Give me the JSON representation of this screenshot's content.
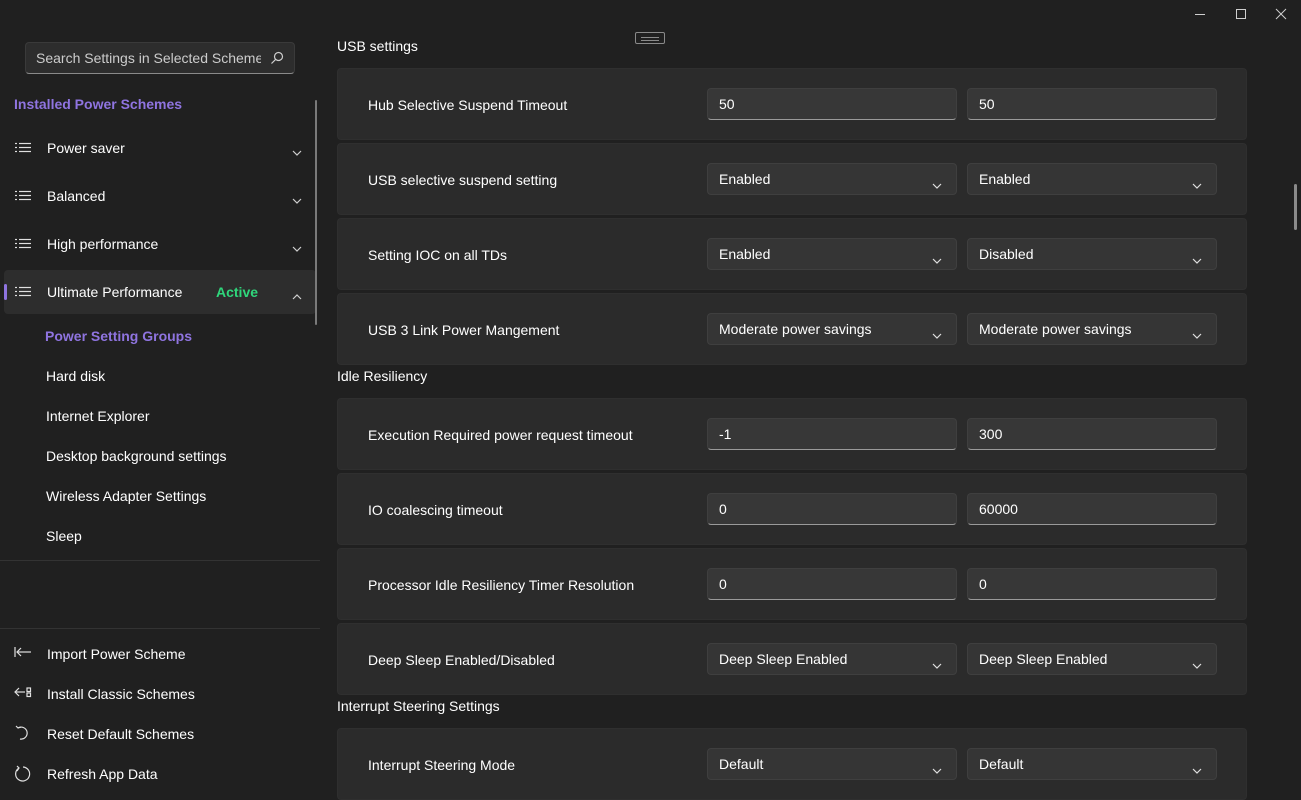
{
  "window": {
    "minimize": "minimize",
    "maximize": "maximize",
    "close": "close"
  },
  "sidebar": {
    "search_placeholder": "Search Settings in Selected Scheme",
    "section_title": "Installed Power Schemes",
    "schemes": [
      {
        "label": "Power saver",
        "expanded": false
      },
      {
        "label": "Balanced",
        "expanded": false
      },
      {
        "label": "High performance",
        "expanded": false
      },
      {
        "label": "Ultimate Performance",
        "expanded": true,
        "badge": "Active"
      }
    ],
    "group_header": "Power Setting Groups",
    "groups": [
      "Hard disk",
      "Internet Explorer",
      "Desktop background settings",
      "Wireless Adapter Settings",
      "Sleep"
    ],
    "actions": [
      {
        "label": "Import Power Scheme",
        "icon": "import-icon"
      },
      {
        "label": "Install Classic Schemes",
        "icon": "install-icon"
      },
      {
        "label": "Reset Default Schemes",
        "icon": "reset-icon"
      },
      {
        "label": "Refresh App Data",
        "icon": "refresh-icon"
      }
    ]
  },
  "main": {
    "sections": [
      {
        "title": "USB settings",
        "settings": [
          {
            "name": "Hub Selective Suspend Timeout",
            "type": "text",
            "value1": "50",
            "value2": "50"
          },
          {
            "name": "USB selective suspend setting",
            "type": "select",
            "value1": "Enabled",
            "value2": "Enabled"
          },
          {
            "name": "Setting IOC on all TDs",
            "type": "select",
            "value1": "Enabled",
            "value2": "Disabled"
          },
          {
            "name": "USB 3 Link Power Mangement",
            "type": "select",
            "value1": "Moderate power savings",
            "value2": "Moderate power savings"
          }
        ]
      },
      {
        "title": "Idle Resiliency",
        "settings": [
          {
            "name": "Execution Required power request timeout",
            "type": "text",
            "value1": "-1",
            "value2": "300"
          },
          {
            "name": "IO coalescing timeout",
            "type": "text",
            "value1": "0",
            "value2": "60000"
          },
          {
            "name": "Processor Idle Resiliency Timer Resolution",
            "type": "text",
            "value1": "0",
            "value2": "0"
          },
          {
            "name": "Deep Sleep Enabled/Disabled",
            "type": "select",
            "value1": "Deep Sleep Enabled",
            "value2": "Deep Sleep Enabled"
          }
        ]
      },
      {
        "title": "Interrupt Steering Settings",
        "settings": [
          {
            "name": "Interrupt Steering Mode",
            "type": "select",
            "value1": "Default",
            "value2": "Default"
          }
        ]
      }
    ]
  },
  "colors": {
    "accent": "#8f74e0",
    "active": "#2fd67b",
    "background": "#202020",
    "card": "#2b2b2b"
  }
}
